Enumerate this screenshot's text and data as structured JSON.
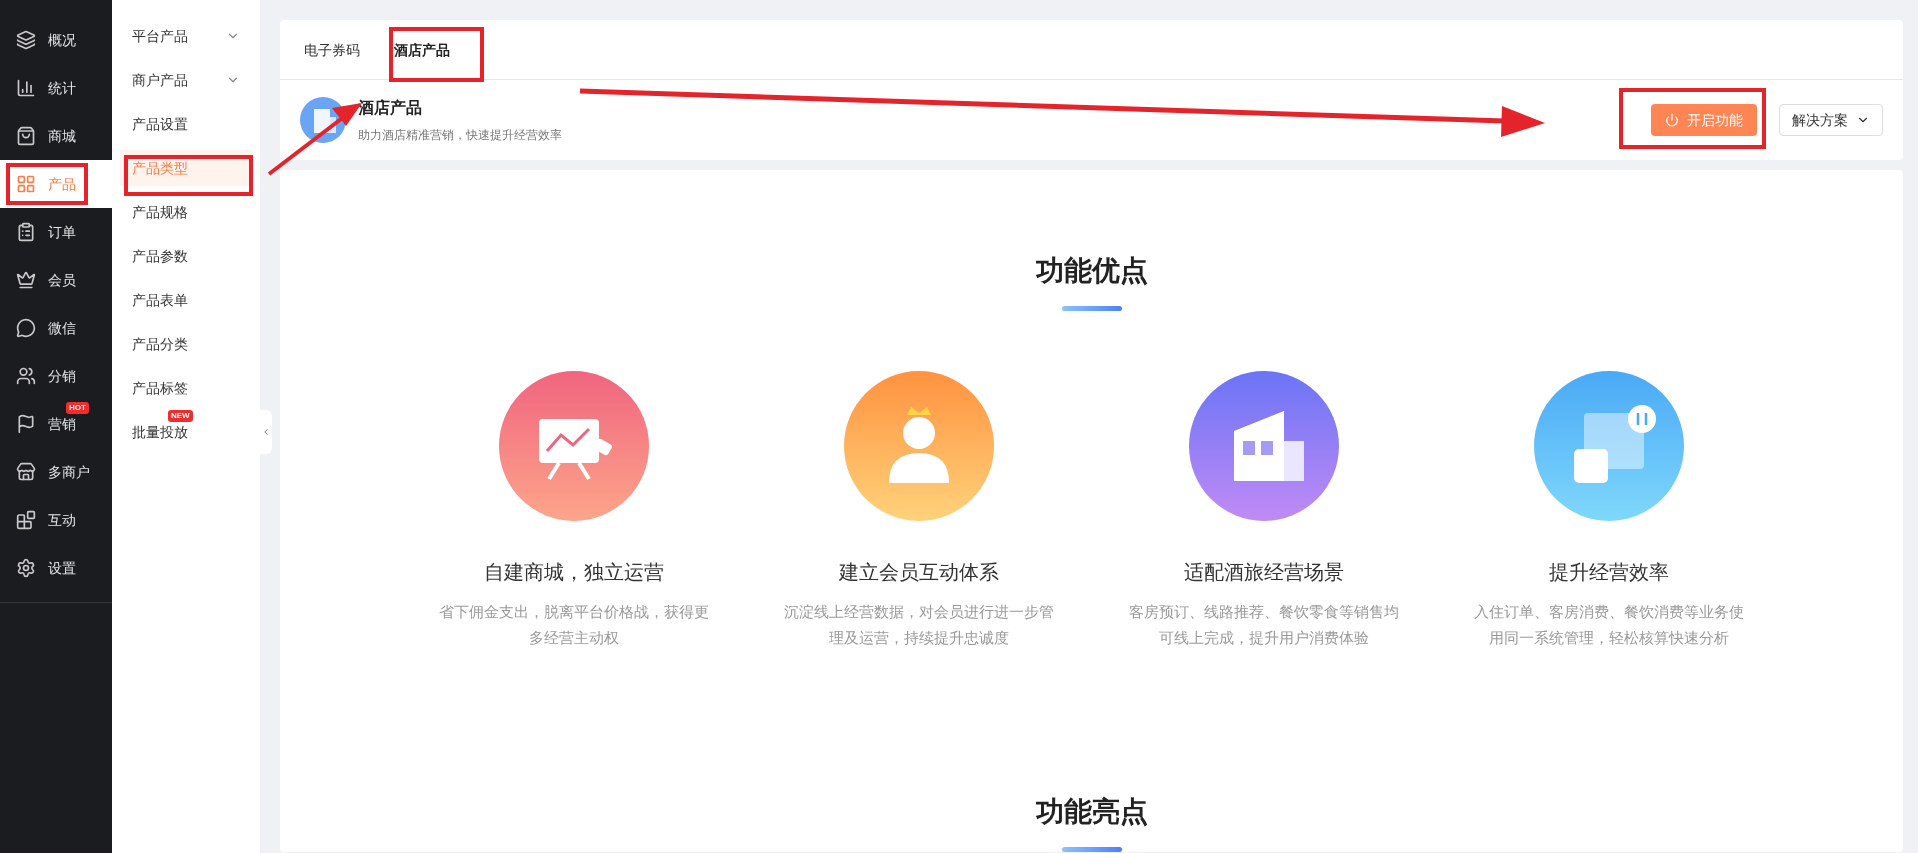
{
  "sidebar": {
    "items": [
      {
        "label": "概况",
        "selected": false
      },
      {
        "label": "统计",
        "selected": false
      },
      {
        "label": "商城",
        "selected": false
      },
      {
        "label": "产品",
        "selected": true
      },
      {
        "label": "订单",
        "selected": false
      },
      {
        "label": "会员",
        "selected": false
      },
      {
        "label": "微信",
        "selected": false
      },
      {
        "label": "分销",
        "selected": false
      },
      {
        "label": "营销",
        "selected": false,
        "badge": "HOT"
      },
      {
        "label": "多商户",
        "selected": false
      },
      {
        "label": "互动",
        "selected": false
      },
      {
        "label": "设置",
        "selected": false
      }
    ]
  },
  "submenu": {
    "items": [
      {
        "label": "平台产品",
        "selected": false,
        "expandable": true
      },
      {
        "label": "商户产品",
        "selected": false,
        "expandable": true
      },
      {
        "label": "产品设置",
        "selected": false,
        "expandable": false
      },
      {
        "label": "产品类型",
        "selected": true,
        "expandable": false
      },
      {
        "label": "产品规格",
        "selected": false,
        "expandable": false
      },
      {
        "label": "产品参数",
        "selected": false,
        "expandable": false
      },
      {
        "label": "产品表单",
        "selected": false,
        "expandable": false
      },
      {
        "label": "产品分类",
        "selected": false,
        "expandable": false
      },
      {
        "label": "产品标签",
        "selected": false,
        "expandable": false
      },
      {
        "label": "批量投放",
        "selected": false,
        "expandable": false,
        "badge": "NEW"
      }
    ]
  },
  "tabs": [
    {
      "label": "电子券码",
      "selected": false
    },
    {
      "label": "酒店产品",
      "selected": true
    }
  ],
  "header": {
    "title": "酒店产品",
    "subtitle": "助力酒店精准营销，快速提升经营效率",
    "primary_button": "开启功能",
    "dropdown_button": "解决方案"
  },
  "sections": [
    {
      "title": "功能优点",
      "features": [
        {
          "title": "自建商城，独立运营",
          "description": "省下佣金支出，脱离平台价格战，获得更多经营主动权"
        },
        {
          "title": "建立会员互动体系",
          "description": "沉淀线上经营数据，对会员进行进一步管理及运营，持续提升忠诚度"
        },
        {
          "title": "适配酒旅经营场景",
          "description": "客房预订、线路推荐、餐饮零食等销售均可线上完成，提升用户消费体验"
        },
        {
          "title": "提升经营效率",
          "description": "入住订单、客房消费、餐饮消费等业务使用同一系统管理，轻松核算快速分析"
        }
      ]
    },
    {
      "title": "功能亮点"
    }
  ]
}
